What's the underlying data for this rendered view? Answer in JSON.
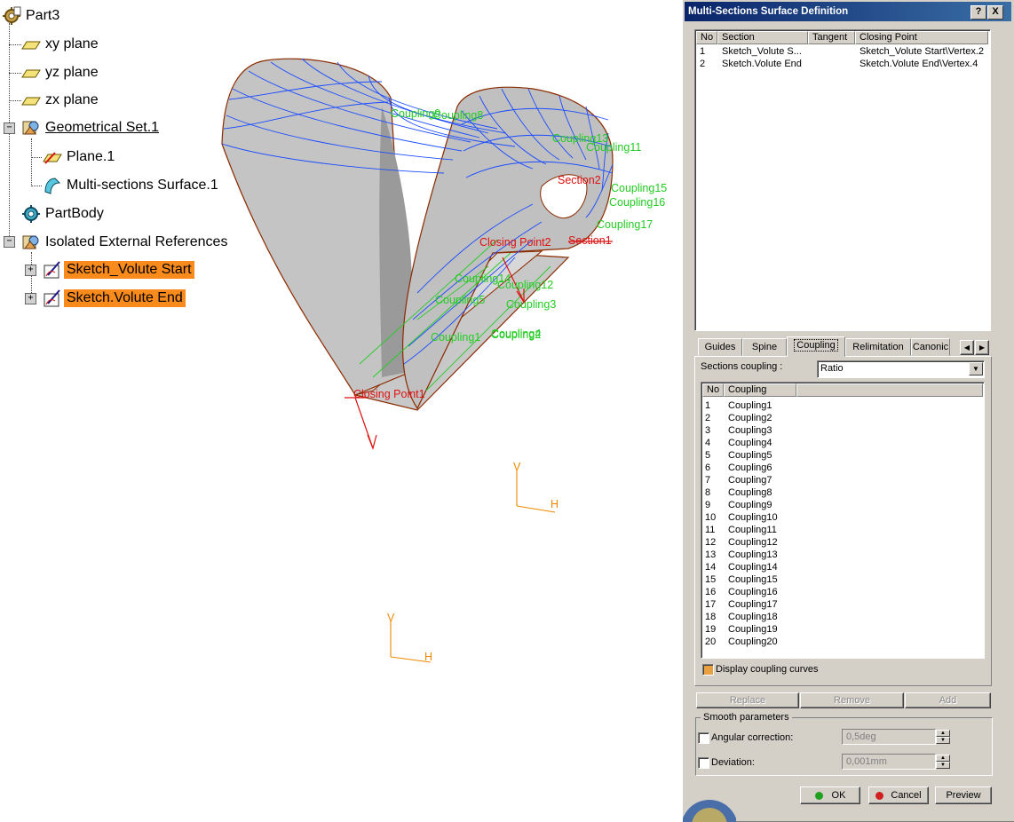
{
  "tree": {
    "root": "Part3",
    "nodes": [
      {
        "label": "xy plane"
      },
      {
        "label": "yz plane"
      },
      {
        "label": "zx plane"
      },
      {
        "label": "Geometrical Set.1"
      },
      {
        "label": "Plane.1"
      },
      {
        "label": "Multi-sections Surface.1"
      },
      {
        "label": "PartBody"
      },
      {
        "label": "Isolated External References"
      },
      {
        "label": "Sketch_Volute Start"
      },
      {
        "label": "Sketch.Volute End"
      }
    ]
  },
  "viewport": {
    "green_labels": [
      "Coupling9",
      "Coupling8",
      "Coupling13",
      "Coupling11",
      "Coupling15",
      "Coupling16",
      "Coupling17",
      "Coupling14",
      "Coupling12",
      "Coupling5",
      "Coupling3",
      "Coupling1",
      "Coupling2",
      "Coupling4"
    ],
    "red_labels": [
      "Closing Point2",
      "Section1",
      "Section2",
      "Closing Point1"
    ],
    "axis_labels": {
      "v": "V",
      "h": "H"
    },
    "colors": {
      "surface": "#c4c4c4",
      "wire": "#1a4bff",
      "green": "#22cc22",
      "red": "#dd1111",
      "axis": "#ee8800",
      "edge": "#8b2a00"
    }
  },
  "dialog": {
    "title": "Multi-Sections Surface Definition",
    "help_button": "?",
    "close_button": "X",
    "sections_headers": [
      "No",
      "Section",
      "Tangent",
      "Closing Point"
    ],
    "sections_rows": [
      {
        "no": "1",
        "section": "Sketch_Volute S...",
        "tangent": "",
        "closing": "Sketch_Volute Start\\Vertex.2"
      },
      {
        "no": "2",
        "section": "Sketch.Volute End",
        "tangent": "",
        "closing": "Sketch.Volute End\\Vertex.4"
      }
    ],
    "tabs": [
      "Guides",
      "Spine",
      "Coupling",
      "Relimitation",
      "Canonic"
    ],
    "active_tab": "Coupling",
    "sections_coupling_label": "Sections coupling :",
    "sections_coupling_value": "Ratio",
    "coupling_headers": [
      "No",
      "Coupling"
    ],
    "coupling_rows": [
      {
        "no": "1",
        "name": "Coupling1"
      },
      {
        "no": "2",
        "name": "Coupling2"
      },
      {
        "no": "3",
        "name": "Coupling3"
      },
      {
        "no": "4",
        "name": "Coupling4"
      },
      {
        "no": "5",
        "name": "Coupling5"
      },
      {
        "no": "6",
        "name": "Coupling6"
      },
      {
        "no": "7",
        "name": "Coupling7"
      },
      {
        "no": "8",
        "name": "Coupling8"
      },
      {
        "no": "9",
        "name": "Coupling9"
      },
      {
        "no": "10",
        "name": "Coupling10"
      },
      {
        "no": "11",
        "name": "Coupling11"
      },
      {
        "no": "12",
        "name": "Coupling12"
      },
      {
        "no": "13",
        "name": "Coupling13"
      },
      {
        "no": "14",
        "name": "Coupling14"
      },
      {
        "no": "15",
        "name": "Coupling15"
      },
      {
        "no": "16",
        "name": "Coupling16"
      },
      {
        "no": "17",
        "name": "Coupling17"
      },
      {
        "no": "18",
        "name": "Coupling18"
      },
      {
        "no": "19",
        "name": "Coupling19"
      },
      {
        "no": "20",
        "name": "Coupling20"
      }
    ],
    "display_coupling_curves": "Display coupling curves",
    "replace_button": "Replace",
    "remove_button": "Remove",
    "add_button": "Add",
    "smooth_parameters": "Smooth parameters",
    "angular_correction_label": "Angular correction:",
    "angular_correction_value": "0,5deg",
    "deviation_label": "Deviation:",
    "deviation_value": "0,001mm",
    "ok_button": "OK",
    "cancel_button": "Cancel",
    "preview_button": "Preview"
  }
}
